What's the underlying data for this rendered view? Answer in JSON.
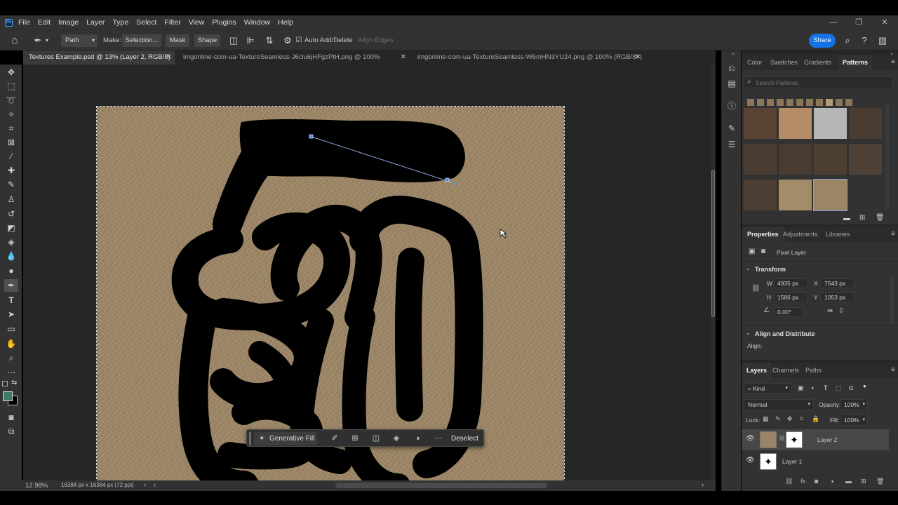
{
  "menubar": {
    "logo": "Ps",
    "items": [
      "File",
      "Edit",
      "Image",
      "Layer",
      "Type",
      "Select",
      "Filter",
      "View",
      "Plugins",
      "Window",
      "Help"
    ]
  },
  "options": {
    "mode": "Path",
    "make_label": "Make:",
    "selection_btn": "Selection...",
    "mask_btn": "Mask",
    "shape_btn": "Shape",
    "auto_add_delete": "Auto Add/Delete",
    "align_edges": "Align Edges",
    "share": "Share"
  },
  "tabs": [
    {
      "label": "Textures Example.psd @ 13% (Layer 2, RGB/8) *"
    },
    {
      "label": "imgonline-com-ua-TextureSeamless-J6clu6jHFgzPtH.png @ 100% (RGB/8#)"
    },
    {
      "label": "imgonline-com-ua-TextureSeamless-W6mHN3YU24.png @ 100% (RGB/8#)"
    }
  ],
  "contextbar": {
    "generative_fill": "Generative Fill",
    "deselect": "Deselect"
  },
  "status": {
    "zoom": "12.98%",
    "doc_info": "16384 px x 16384 px (72 ppi)"
  },
  "panels": {
    "top_tabs": [
      "Color",
      "Swatches",
      "Gradients",
      "Patterns"
    ],
    "search_placeholder": "Search Patterns",
    "properties_tabs": [
      "Properties",
      "Adjustments",
      "Libraries"
    ],
    "pixel_layer": "Pixel Layer",
    "transform": "Transform",
    "w_label": "W",
    "w_value": "4935 px",
    "x_label": "X",
    "x_value": "7543 px",
    "h_label": "H",
    "h_value": "1586 px",
    "y_label": "Y",
    "y_value": "1053 px",
    "angle_value": "0.00°",
    "align_distribute": "Align and Distribute",
    "align_label": "Align:",
    "layers_tabs": [
      "Layers",
      "Channels",
      "Paths"
    ],
    "kind": "Kind",
    "blend_mode": "Normal",
    "opacity_label": "Opacity:",
    "opacity_value": "100%",
    "lock_label": "Lock:",
    "fill_label": "Fill:",
    "fill_value": "100%",
    "layers": [
      {
        "name": "Layer 2"
      },
      {
        "name": "Layer 1"
      }
    ]
  },
  "colors": {
    "accent": "#1473e6",
    "foreground": "#3d7a66",
    "background": "#000000"
  }
}
